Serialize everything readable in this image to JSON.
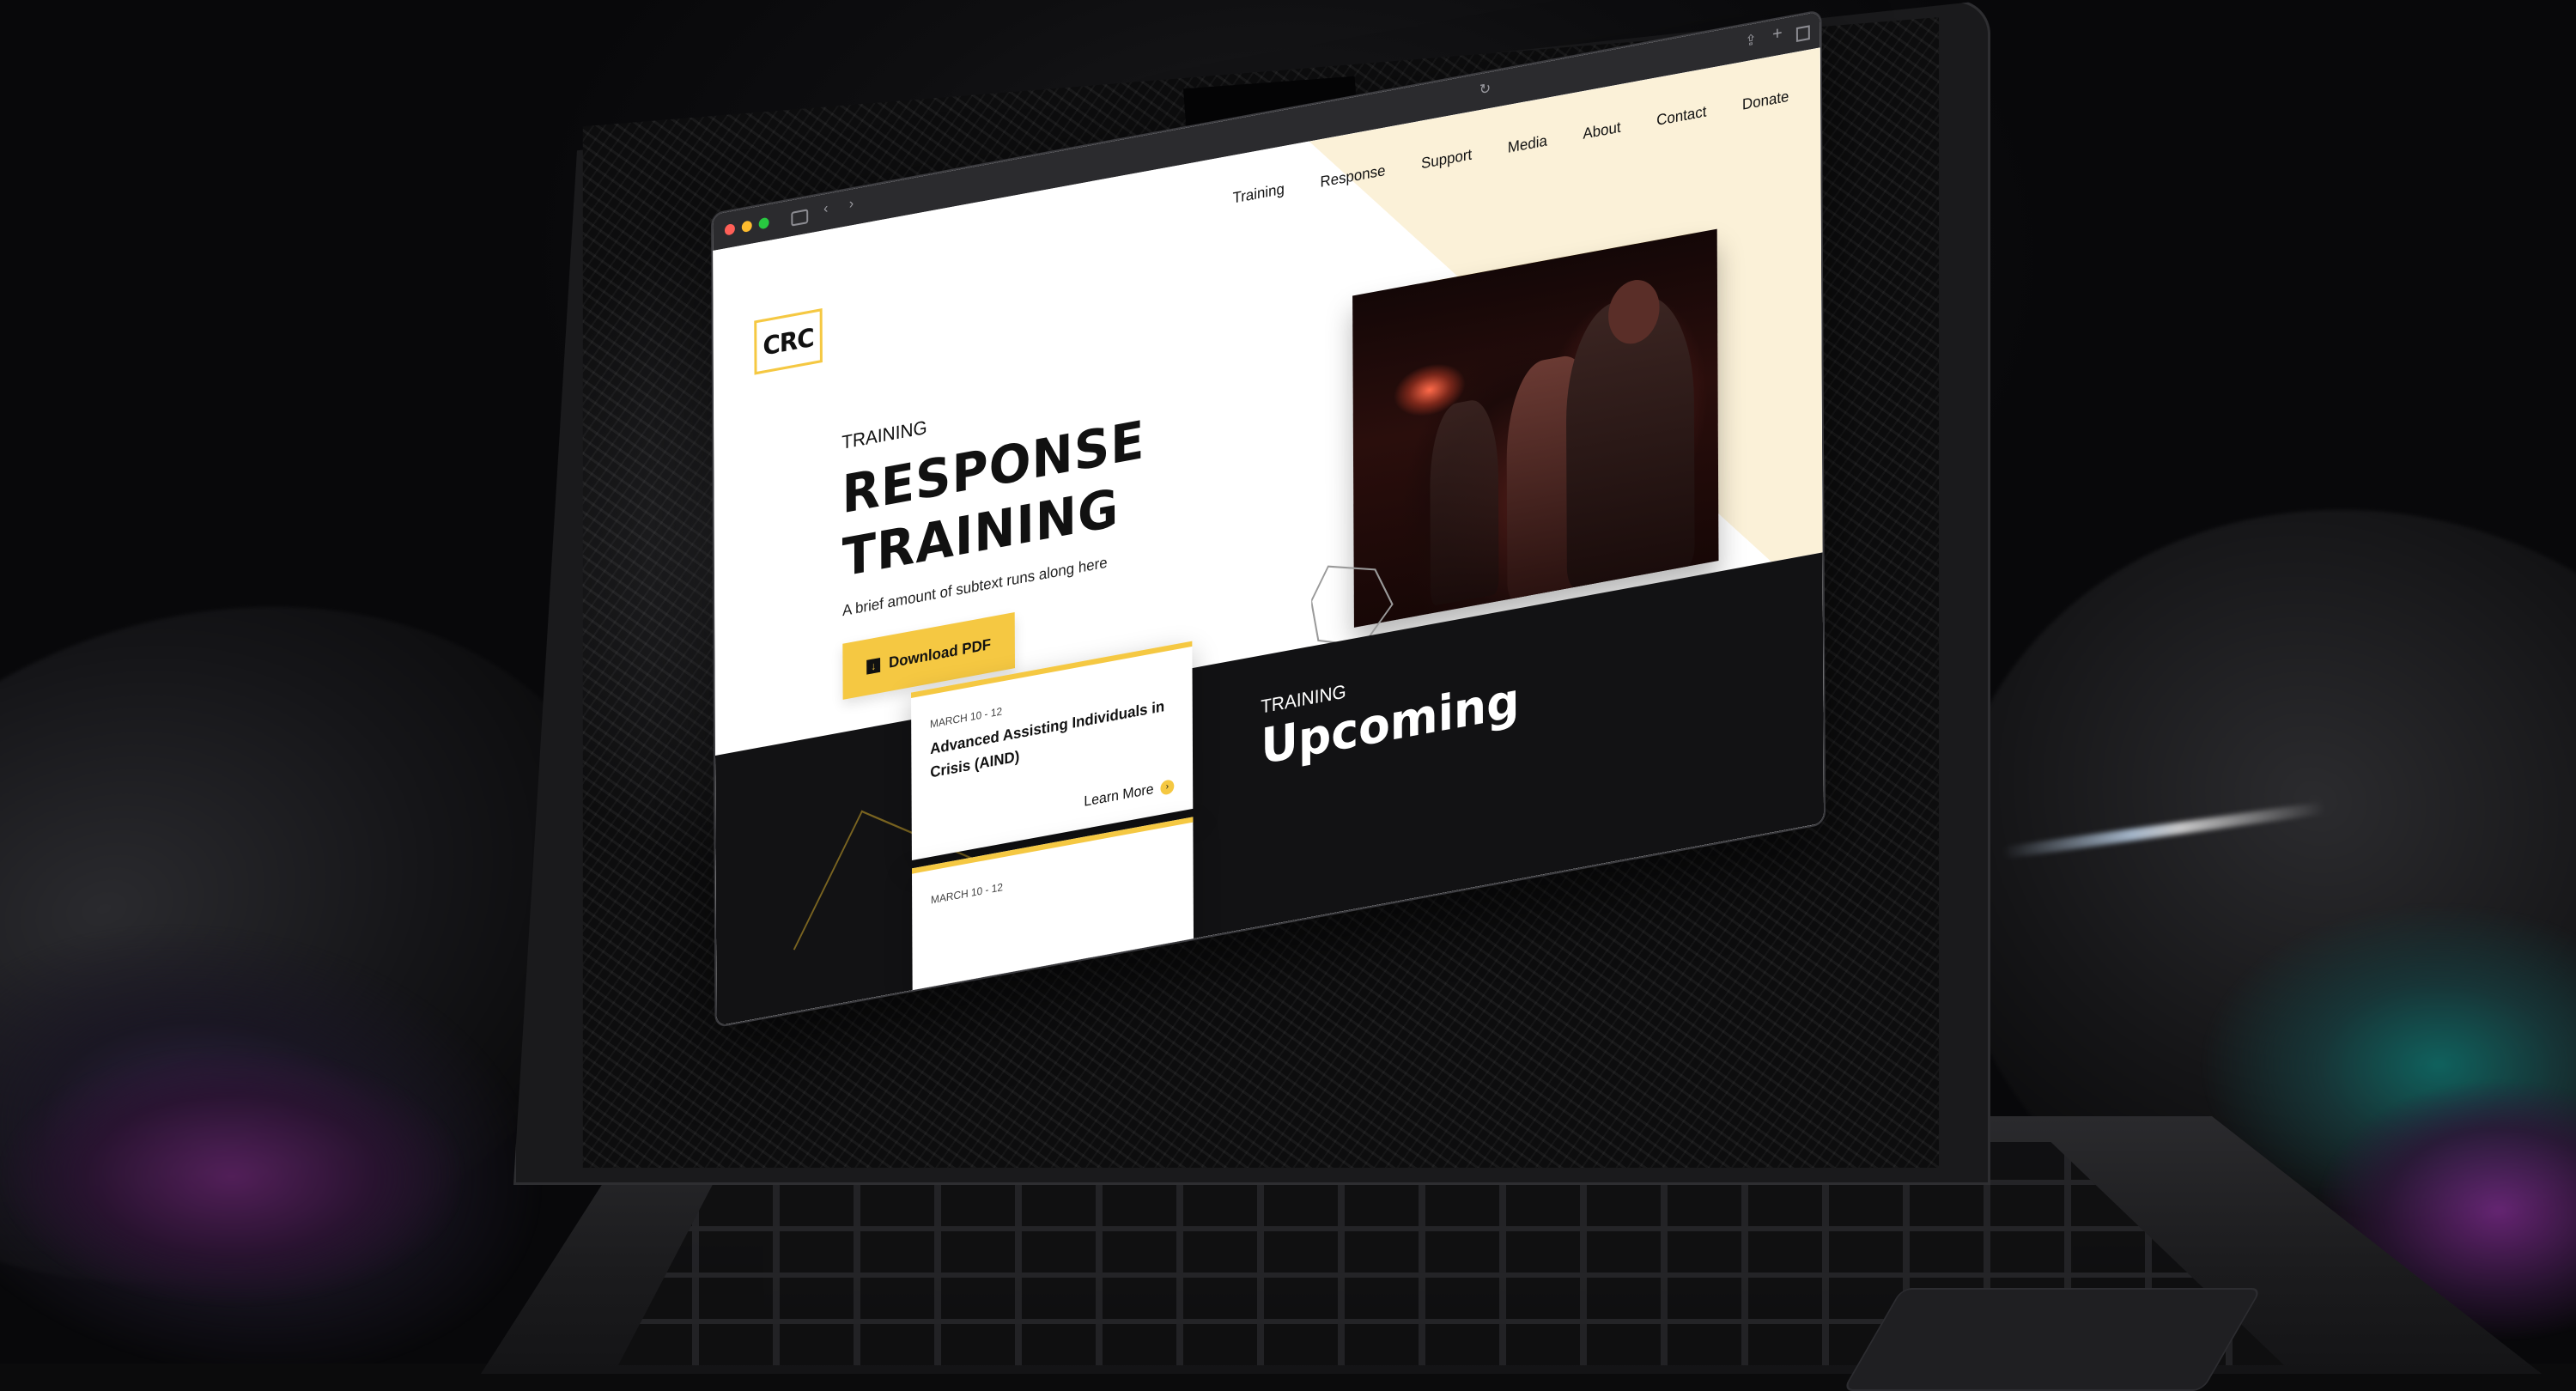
{
  "browser": {
    "icons": [
      "sidebar-icon",
      "back-icon",
      "forward-icon",
      "reload-icon",
      "share-icon",
      "new-tab-icon",
      "tab-overview-icon"
    ]
  },
  "site": {
    "logo": "CRC",
    "nav": [
      "Training",
      "Response",
      "Support",
      "Media",
      "About",
      "Contact",
      "Donate"
    ],
    "accent_color": "#f5c842",
    "beige_color": "#fbf1d8",
    "dark_color": "#121214"
  },
  "hero": {
    "eyebrow": "TRAINING",
    "title_line1": "RESPONSE",
    "title_line2": "TRAINING",
    "subtext": "A brief amount of subtext runs along here",
    "cta_label": "Download PDF",
    "cta_icon": "download-icon"
  },
  "events": [
    {
      "date": "MARCH 10 - 12",
      "title": "Advanced Assisting Individuals in Crisis (AIND)",
      "link": "Learn More"
    },
    {
      "date": "MARCH 10 - 12",
      "title": "",
      "link": ""
    }
  ],
  "upcoming": {
    "eyebrow": "TRAINING",
    "title": "Upcoming"
  }
}
